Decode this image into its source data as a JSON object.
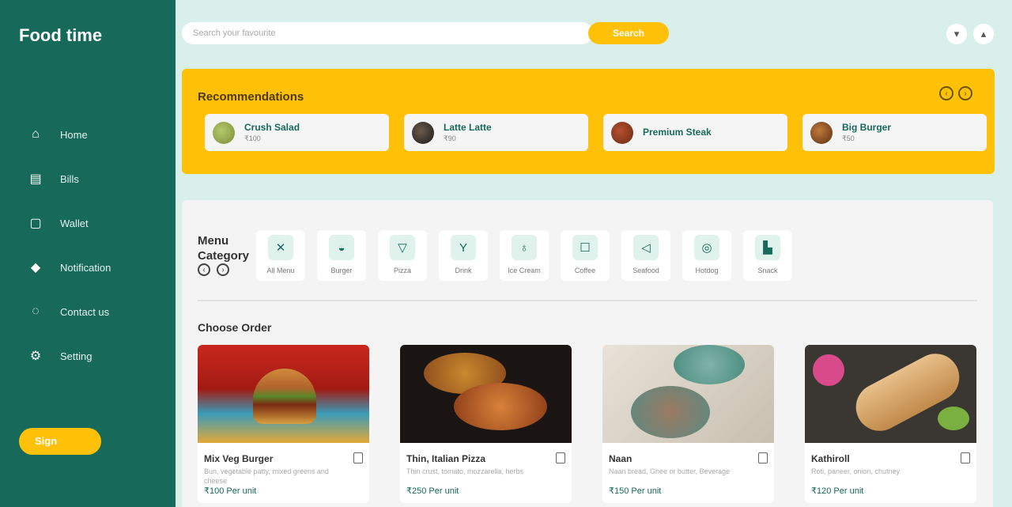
{
  "sidebar": {
    "brand": "Food time",
    "items": [
      {
        "label": "Home",
        "icon": "home-icon"
      },
      {
        "label": "Bills",
        "icon": "bills-icon"
      },
      {
        "label": "Wallet",
        "icon": "wallet-icon"
      },
      {
        "label": "Notification",
        "icon": "bell-icon"
      },
      {
        "label": "Contact us",
        "icon": "chat-icon"
      },
      {
        "label": "Setting",
        "icon": "gear-icon"
      }
    ],
    "logout_label": "Sign"
  },
  "topbar": {
    "search_placeholder": "Search your favourite",
    "search_button": "Search"
  },
  "recommendations": {
    "title": "Recommendations",
    "items": [
      {
        "name": "Crush Salad",
        "price": "₹100"
      },
      {
        "name": "Latte Latte",
        "price": "₹90"
      },
      {
        "name": "Premium Steak",
        "price": ""
      },
      {
        "name": "Big Burger",
        "price": "₹50"
      }
    ]
  },
  "menu": {
    "title_line1": "Menu",
    "title_line2": "Category",
    "categories": [
      {
        "label": "All Menu",
        "icon": "cutlery-icon"
      },
      {
        "label": "Burger",
        "icon": "burger-icon"
      },
      {
        "label": "Pizza",
        "icon": "pizza-icon"
      },
      {
        "label": "Drink",
        "icon": "drink-icon"
      },
      {
        "label": "Ice Cream",
        "icon": "ice-cream-icon"
      },
      {
        "label": "Coffee",
        "icon": "coffee-icon"
      },
      {
        "label": "Seafood",
        "icon": "fish-icon"
      },
      {
        "label": "Hotdog",
        "icon": "hotdog-icon"
      },
      {
        "label": "Snack",
        "icon": "snack-icon"
      }
    ]
  },
  "order": {
    "title": "Choose Order",
    "items": [
      {
        "name": "Mix Veg Burger",
        "desc": "Bun, vegetable patty, mixed greens and cheese",
        "price": "₹100 Per unit"
      },
      {
        "name": "Thin, Italian Pizza",
        "desc": "Thin crust, tomato, mozzarella, herbs",
        "price": "₹250 Per unit"
      },
      {
        "name": "Naan",
        "desc": "Naan bread, Ghee or butter, Beverage",
        "price": "₹150 Per unit"
      },
      {
        "name": "Kathiroll",
        "desc": "Roti, paneer, onion, chutney",
        "price": "₹120 Per unit"
      }
    ]
  }
}
